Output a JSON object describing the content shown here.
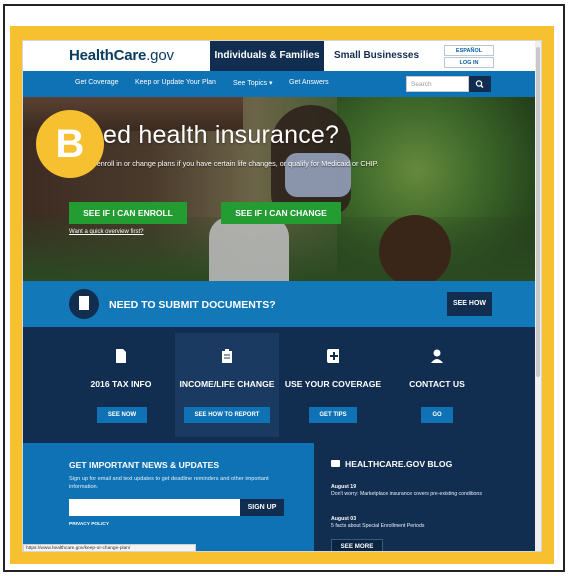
{
  "header": {
    "logo_bold": "HealthCare",
    "logo_thin": ".gov",
    "tab_individuals": "Individuals & Families",
    "tab_business": "Small Businesses",
    "espanol": "ESPAÑOL",
    "login": "LOG IN"
  },
  "nav": {
    "items": [
      "Get Coverage",
      "Keep or Update Your Plan",
      "See Topics ▾",
      "Get Answers"
    ],
    "search_placeholder": "Search"
  },
  "hero": {
    "title": "ed health insurance?",
    "subtitle": "You can enroll in or change plans if you have certain life changes, or qualify for Medicaid or CHIP.",
    "btn_enroll": "SEE IF I CAN ENROLL",
    "btn_change": "SEE IF I CAN CHANGE",
    "link": "Want a quick overview first?",
    "badge": "B"
  },
  "docs": {
    "title": "NEED TO SUBMIT DOCUMENTS?",
    "button": "SEE HOW"
  },
  "tiles": [
    {
      "title": "2016 TAX INFO",
      "button": "SEE NOW"
    },
    {
      "title": "INCOME/LIFE CHANGE",
      "button": "SEE HOW TO REPORT"
    },
    {
      "title": "USE YOUR COVERAGE",
      "button": "GET TIPS"
    },
    {
      "title": "CONTACT US",
      "button": "GO"
    }
  ],
  "news": {
    "title": "GET IMPORTANT NEWS & UPDATES",
    "desc": "Sign up for email and text updates to get deadline reminders and other important information.",
    "signup": "SIGN UP",
    "privacy": "PRIVACY POLICY"
  },
  "blog": {
    "title": "HEALTHCARE.GOV BLOG",
    "posts": [
      {
        "date": "August 19",
        "text": "Don't worry: Marketplace insurance covers pre-existing conditions"
      },
      {
        "date": "August 03",
        "text": "5 facts about Special Enrollment Periods"
      }
    ],
    "see_more": "SEE MORE"
  },
  "status_url": "https://www.healthcare.gov/keep-or-change-plan/",
  "colors": {
    "brand_navy": "#112e51",
    "brand_blue": "#0e72b5",
    "green": "#239d31",
    "frame_yellow": "#f6c030"
  }
}
